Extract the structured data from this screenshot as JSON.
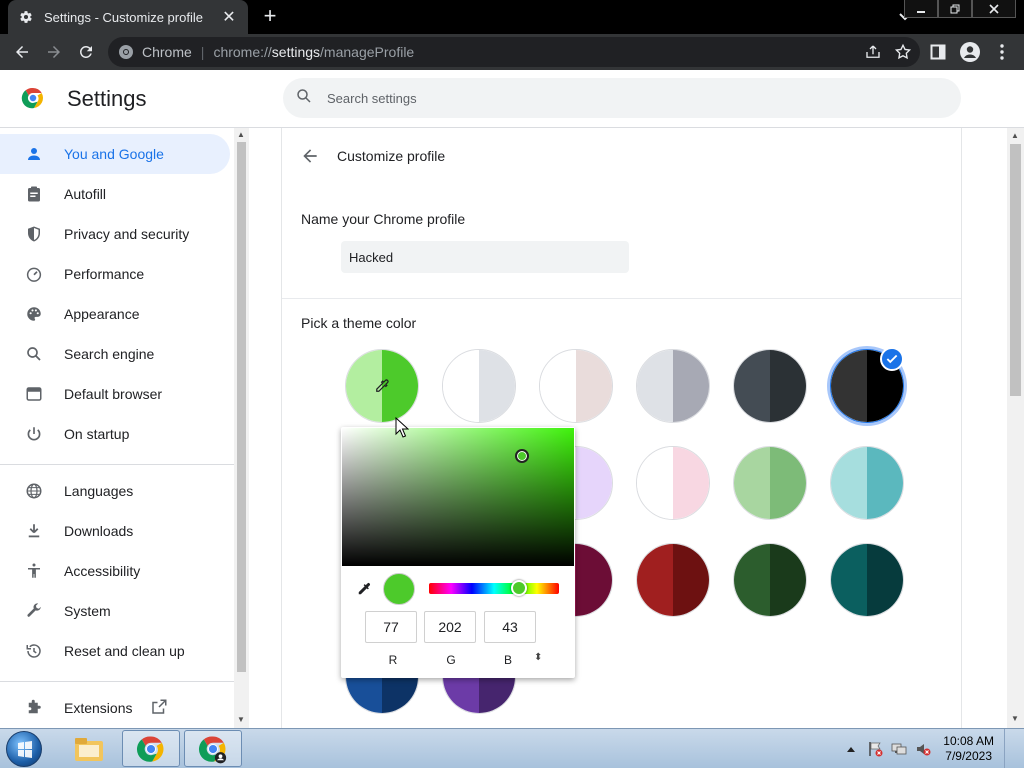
{
  "browser": {
    "tab_title": "Settings - Customize profile",
    "close_symbol": "✕",
    "new_tab_symbol": "+",
    "omnibox": {
      "site_label": "Chrome",
      "url_scheme": "chrome://",
      "url_host": "settings",
      "url_path": "/manageProfile"
    }
  },
  "header": {
    "title": "Settings",
    "search_placeholder": "Search settings"
  },
  "sidebar": {
    "items": [
      {
        "label": "You and Google",
        "icon": "person-icon",
        "active": true
      },
      {
        "label": "Autofill",
        "icon": "clipboard-icon"
      },
      {
        "label": "Privacy and security",
        "icon": "shield-icon"
      },
      {
        "label": "Performance",
        "icon": "speedometer-icon"
      },
      {
        "label": "Appearance",
        "icon": "palette-icon"
      },
      {
        "label": "Search engine",
        "icon": "search-icon"
      },
      {
        "label": "Default browser",
        "icon": "browser-window-icon"
      },
      {
        "label": "On startup",
        "icon": "power-icon"
      },
      {
        "label": "Languages",
        "icon": "globe-icon"
      },
      {
        "label": "Downloads",
        "icon": "download-icon"
      },
      {
        "label": "Accessibility",
        "icon": "accessibility-icon"
      },
      {
        "label": "System",
        "icon": "wrench-icon"
      },
      {
        "label": "Reset and clean up",
        "icon": "history-icon"
      },
      {
        "label": "Extensions",
        "icon": "puzzle-icon"
      }
    ]
  },
  "profile": {
    "title": "Customize profile",
    "name_label": "Name your Chrome profile",
    "name_value": "Hacked",
    "theme_label": "Pick a theme color",
    "swatches": [
      {
        "left": "#b3eea0",
        "right": "#4dca2b",
        "name": "custom"
      },
      {
        "left": "#ffffff",
        "right": "#dee1e6"
      },
      {
        "left": "#ffffff",
        "right": "#e9dcdb"
      },
      {
        "left": "#dee1e6",
        "right": "#a7a9b4"
      },
      {
        "left": "#444c54",
        "right": "#2b3135"
      },
      {
        "left": "#333333",
        "right": "#000000",
        "selected": true
      },
      {
        "left": "#ffffff",
        "right": "#c9e9c0"
      },
      {
        "left": "#ffffff",
        "right": "#b2e5f0"
      },
      {
        "left": "#ffffff",
        "right": "#e6d5fb"
      },
      {
        "left": "#ffffff",
        "right": "#f8d7e2"
      },
      {
        "left": "#a8d6a0",
        "right": "#7dbb78"
      },
      {
        "left": "#a6dede",
        "right": "#5bb8be"
      },
      {
        "left": "#c6d7f6",
        "right": "#82a9e9"
      },
      {
        "left": "#fed4db",
        "right": "#fca4b2"
      },
      {
        "left": "#9c1651",
        "right": "#6c0d36"
      },
      {
        "left": "#a01f1f",
        "right": "#6d1111"
      },
      {
        "left": "#2c5d2d",
        "right": "#1a3a1b"
      },
      {
        "left": "#0b5f5f",
        "right": "#063b3d"
      },
      {
        "left": "#184f99",
        "right": "#0d3366"
      },
      {
        "left": "#6c3ba7",
        "right": "#46256e"
      }
    ]
  },
  "color_picker": {
    "preview_color": "#4dca2b",
    "r": "77",
    "g": "202",
    "b": "43",
    "r_label": "R",
    "g_label": "G",
    "b_label": "B",
    "format_toggle": "⬍"
  },
  "taskbar": {
    "time": "10:08 AM",
    "date": "7/9/2023"
  }
}
